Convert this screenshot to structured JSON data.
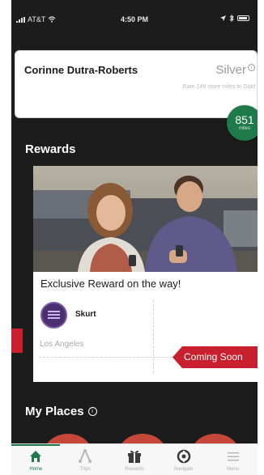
{
  "status_bar": {
    "carrier": "AT&T",
    "time": "4:50 PM"
  },
  "member": {
    "name": "Corinne Dutra-Roberts",
    "tier": "Silver",
    "tier_info": "i",
    "earn_text": "Earn 149 more miles to Gold",
    "miles_value": "851",
    "miles_unit": "miles"
  },
  "rewards": {
    "title": "Rewards",
    "card": {
      "headline": "Exclusive Reward on the way!",
      "partner": "Skurt",
      "location": "Los Angeles",
      "badge": "Coming Soon"
    }
  },
  "places": {
    "title": "My Places",
    "info": "i"
  },
  "tabbar": {
    "tabs": [
      {
        "label": "Home",
        "icon": "home-icon",
        "active": true
      },
      {
        "label": "Trips",
        "icon": "trips-icon",
        "active": false
      },
      {
        "label": "Rewards",
        "icon": "rewards-icon",
        "active": false
      },
      {
        "label": "Navigate",
        "icon": "navigate-icon",
        "active": false
      },
      {
        "label": "Menu",
        "icon": "menu-icon",
        "active": false
      }
    ]
  },
  "colors": {
    "brand_green": "#1f7a4a",
    "accent_red": "#c8202e",
    "background": "#1c1c1c"
  }
}
